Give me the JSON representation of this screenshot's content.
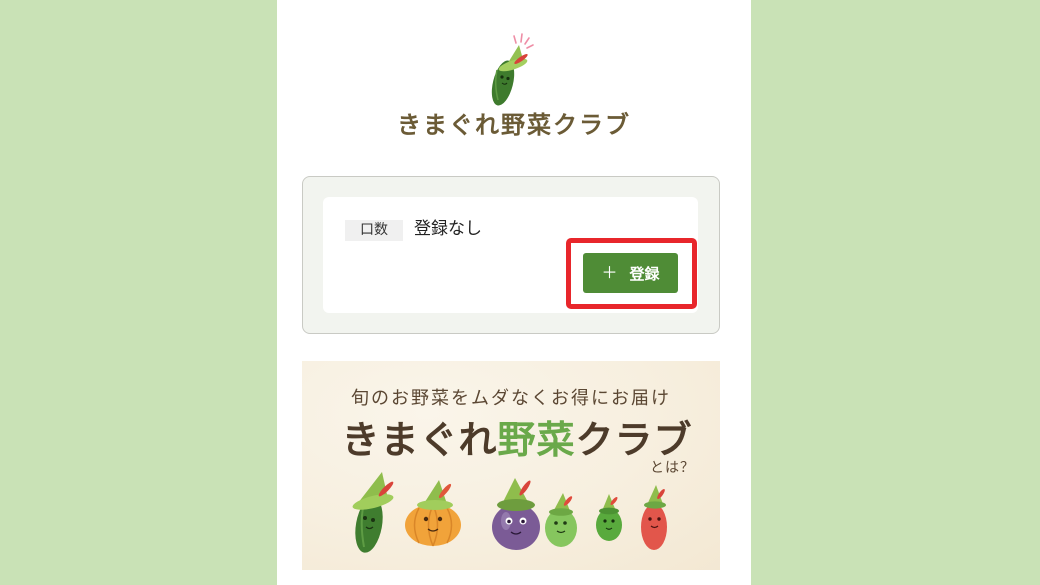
{
  "page": {
    "background_color": "#c9e2b6",
    "content_background": "#ffffff"
  },
  "header": {
    "logo_icon": "cucumber-mascot-icon",
    "brand_name": "きまぐれ野菜クラブ",
    "brand_color": "#6b5b36"
  },
  "subscription_card": {
    "quantity_label": "口数",
    "quantity_value": "登録なし",
    "register_button": {
      "icon": "plus-icon",
      "icon_glyph": "＋",
      "label": "登録",
      "color": "#4f8c36"
    }
  },
  "highlight": {
    "color": "#e8262b"
  },
  "banner": {
    "tagline": "旬のお野菜をムダなくお得にお届け",
    "title_parts": [
      "きまぐれ",
      "野菜",
      "クラブ"
    ],
    "title_suffix": "とは？",
    "characters": [
      "cucumber-character-icon",
      "pumpkin-character-icon",
      "eggplant-character-icon",
      "green-pepper-character-icon",
      "small-green-pepper-character-icon",
      "red-pepper-character-icon"
    ],
    "background_color": "#f7efdf"
  }
}
